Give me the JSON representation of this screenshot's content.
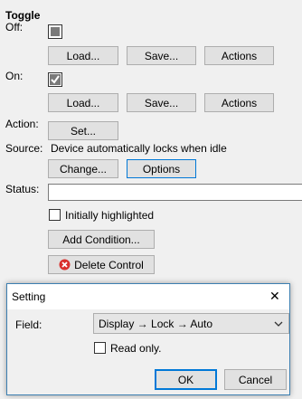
{
  "toggle": {
    "heading": "Toggle",
    "off_label": "Off:",
    "on_label": "On:",
    "load_label": "Load...",
    "save_label": "Save...",
    "actions_label": "Actions"
  },
  "action": {
    "label": "Action:",
    "set_label": "Set..."
  },
  "source": {
    "label": "Source:",
    "value": "Device automatically locks when idle",
    "change_label": "Change...",
    "options_label": "Options"
  },
  "status": {
    "label": "Status:",
    "value": ""
  },
  "initially_highlighted": {
    "label": "Initially highlighted",
    "checked": false
  },
  "add_condition_label": "Add Condition...",
  "delete_control_label": "Delete Control",
  "dialog": {
    "title": "Setting",
    "close_glyph": "✕",
    "field_label": "Field:",
    "field_value": "Display → Lock → Auto",
    "read_only_label": "Read only.",
    "read_only_checked": false,
    "ok_label": "OK",
    "cancel_label": "Cancel"
  },
  "colors": {
    "window_bg": "#f0f0f0",
    "button_bg": "#e1e1e1",
    "focus_border": "#0078d7",
    "delete_icon": "#d9302c"
  }
}
